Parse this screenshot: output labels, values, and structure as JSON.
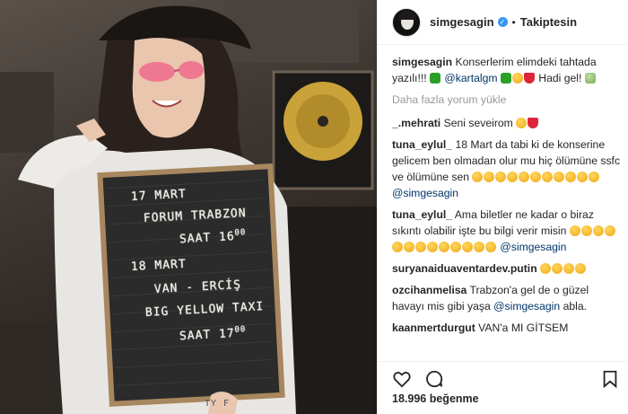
{
  "header": {
    "username": "simgesagin",
    "verified_icon": "verified-badge-icon",
    "separator": "•",
    "follow_label": "Takiptesin"
  },
  "photo": {
    "board_lines": [
      "17 MART",
      "FORUM TRABZON",
      "SAAT 16",
      "00",
      "18 MART",
      "VAN - ERCİŞ",
      "BIG YELLOW TAXI",
      "SAAT 17",
      "00"
    ],
    "shirt_text": "TY F"
  },
  "caption": {
    "username": "simgesagin",
    "text_1": "Konserlerim elimdeki tahtada yazılı!!!",
    "mention": "@kartalgm",
    "text_2": "Hadi gel!"
  },
  "load_more": "Daha fazla yorum yükle",
  "comments": [
    {
      "username": "_.mehrati",
      "text": "Seni seveirom"
    },
    {
      "username": "tuna_eylul_",
      "text": "18 Mart da tabi ki de konserine gelicem ben olmadan olur mu hiç ölümüne ssfc ve ölümüne sen",
      "mention": "@simgesagin"
    },
    {
      "username": "tuna_eylul_",
      "text": "Ama biletler ne kadar o biraz sıkıntı olabilir işte bu bilgi verir misin",
      "mention": "@simgesagin"
    },
    {
      "username": "suryanaiduaventardev.putin",
      "text": ""
    },
    {
      "username": "ozcihanmelisa",
      "text": "Trabzon'a gel de o güzel havayı mis gibi yaşa",
      "mention": "@simgesagin",
      "text_after": "abla."
    },
    {
      "username": "kaanmertdurgut",
      "text": "VAN'a MI GİTSEM"
    }
  ],
  "actions": {
    "like_icon": "heart-icon",
    "comment_icon": "comment-icon",
    "save_icon": "bookmark-icon"
  },
  "likes": {
    "count": "18.996",
    "label": "beğenme"
  },
  "colors": {
    "accent": "#3897f0",
    "mention": "#003569",
    "muted": "#999999"
  }
}
